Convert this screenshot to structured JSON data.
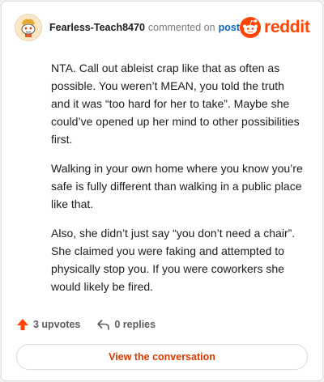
{
  "comment": {
    "username": "Fearless-Teach8470",
    "commented_text": "commented on",
    "post_link": "post",
    "brand": "reddit",
    "paragraphs": [
      "NTA. Call out ableist crap like that as often as possible. You weren’t MEAN, you told the truth and it was “too hard for her to take”. Maybe she could’ve opened up her mind to other possibilities first.",
      "Walking in your own home where you know you’re safe is fully different than walking in a public place like that.",
      "Also, she didn’t just say “you don’t need a chair”. She claimed you were faking and attempted to physically stop you. If you were coworkers she would likely be fired."
    ],
    "upvotes": "3 upvotes",
    "replies": "0 replies",
    "cta": "View the conversation"
  },
  "colors": {
    "brand": "#ff4500",
    "link": "#0b66c3",
    "cta": "#d93a00"
  },
  "icons": {
    "avatar": "snoo-avatar",
    "logo": "reddit-logo-icon",
    "upvote": "upvote-arrow-icon",
    "reply": "reply-arrow-icon"
  }
}
